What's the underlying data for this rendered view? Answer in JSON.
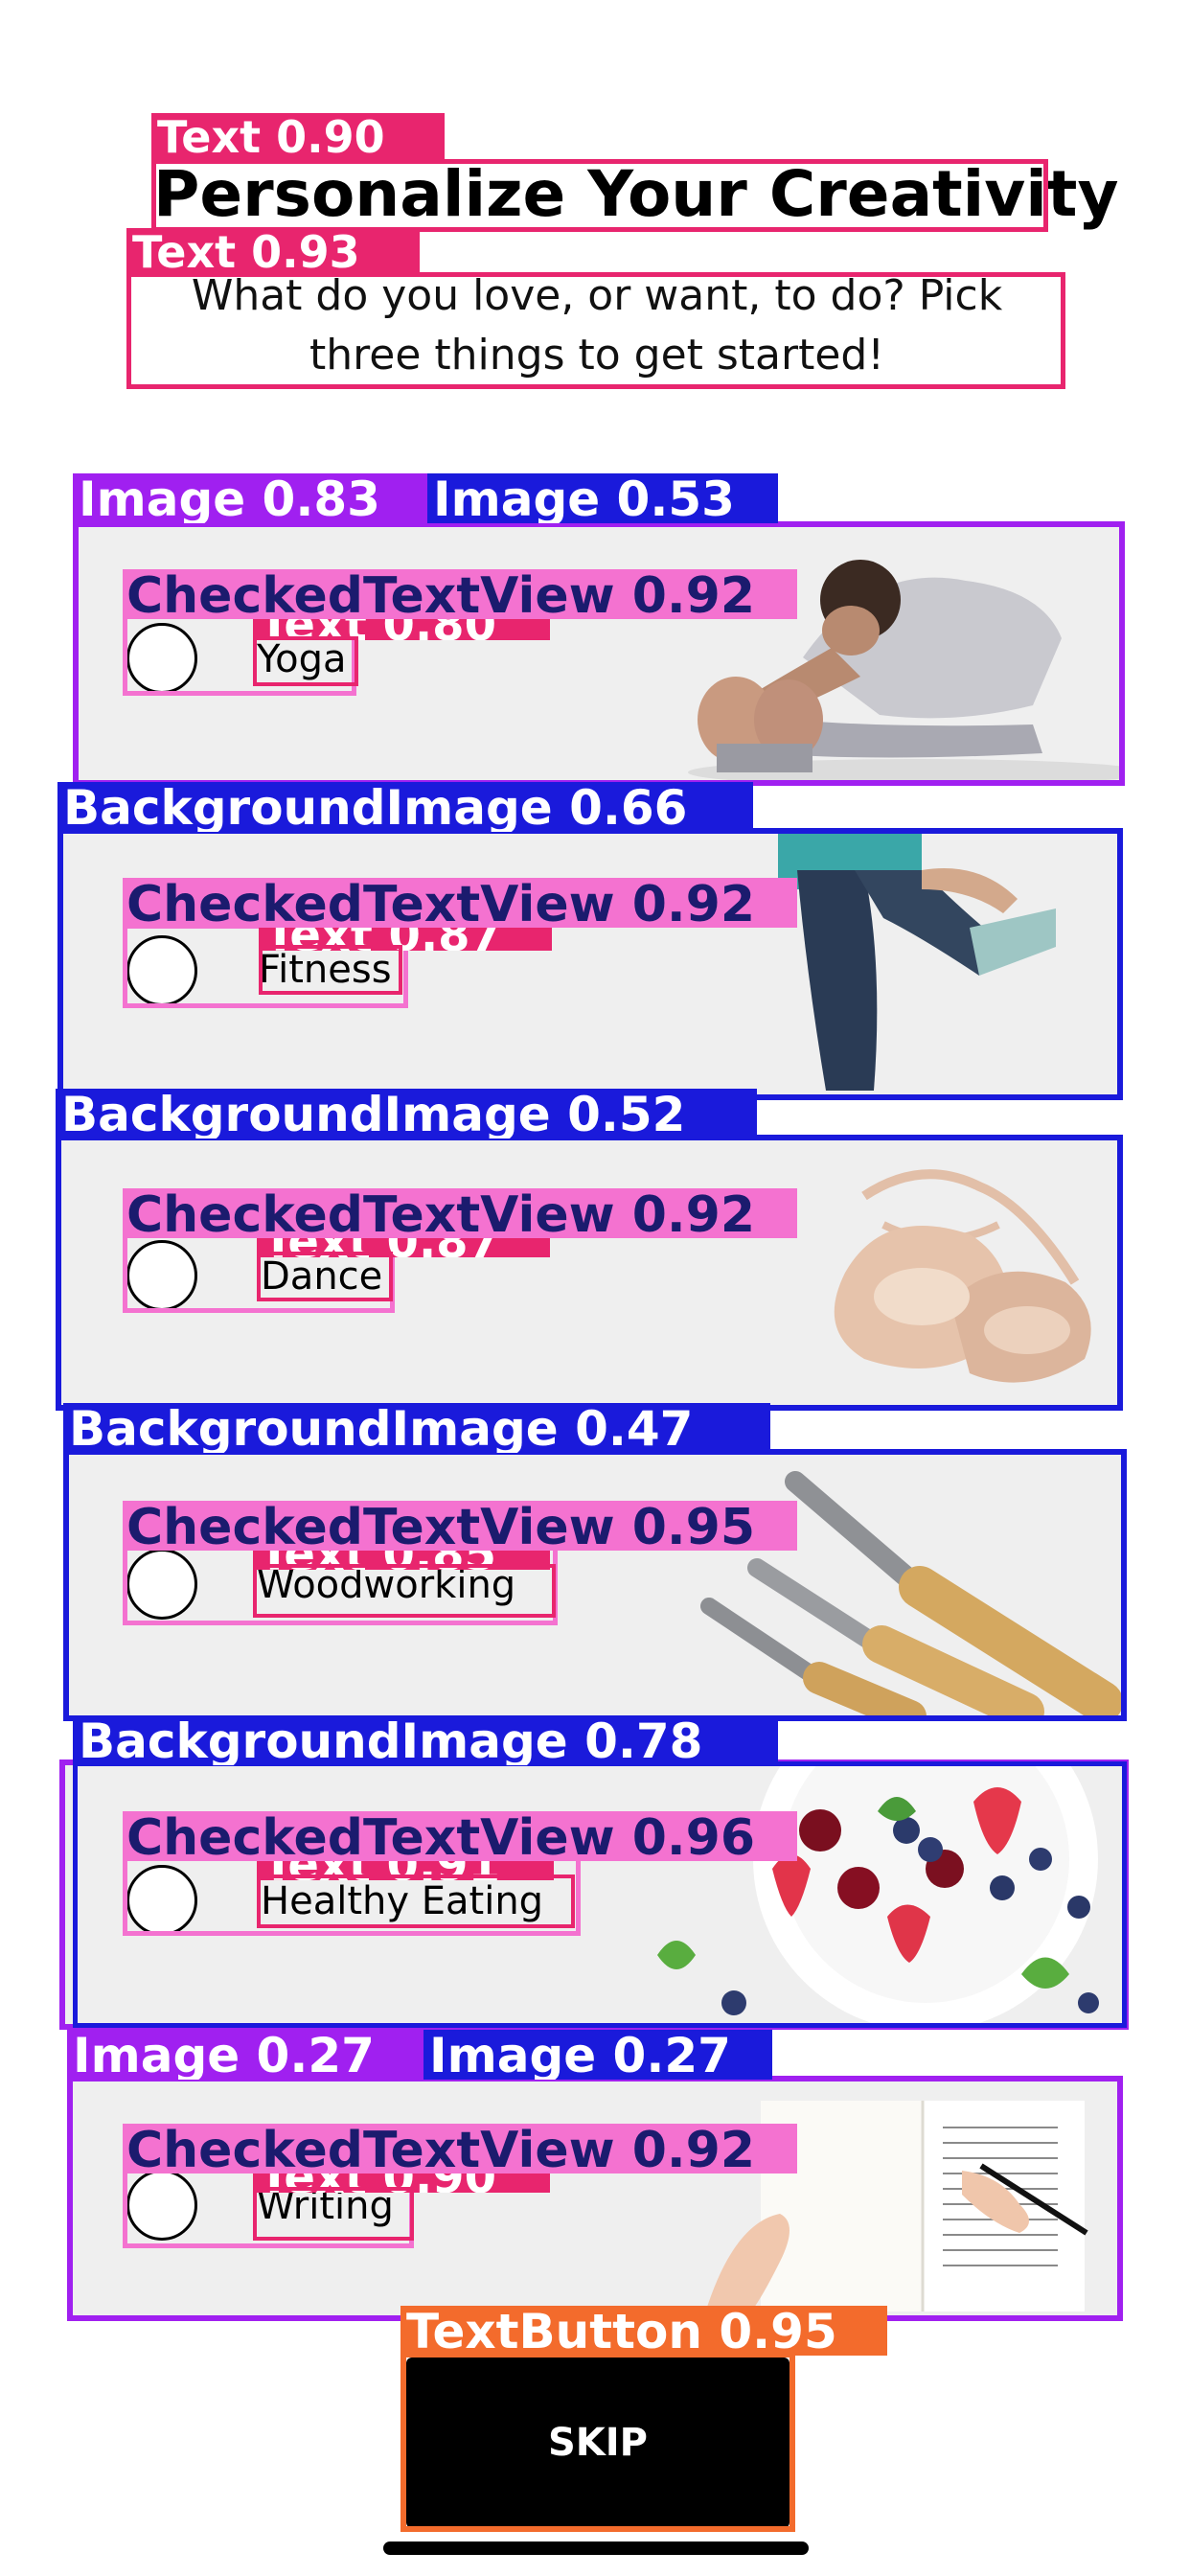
{
  "header": {
    "title": "Personalize Your Creativity",
    "subtitle": "What do you love, or want, to do? Pick three things to get started!"
  },
  "options": [
    {
      "label": "Yoga",
      "checked": false,
      "image": "yoga-woman-stretching"
    },
    {
      "label": "Fitness",
      "checked": false,
      "image": "fitness-legs-leggings"
    },
    {
      "label": "Dance",
      "checked": false,
      "image": "ballet-pointe-shoes"
    },
    {
      "label": "Woodworking",
      "checked": false,
      "image": "wood-chisels"
    },
    {
      "label": "Healthy Eating",
      "checked": false,
      "image": "fruit-bowl-berries"
    },
    {
      "label": "Writing",
      "checked": false,
      "image": "hand-writing-notebook"
    }
  ],
  "skip_button": {
    "label": "SKIP"
  },
  "detections": {
    "title": "Text 0.90",
    "subtitle": "Text 0.93",
    "yoga_image_a": "Image 0.83",
    "yoga_image_b": "Image 0.53",
    "yoga_checked": "CheckedTextView 0.92",
    "yoga_text": "Text 0.80",
    "fitness_bg": "BackgroundImage 0.66",
    "fitness_checked": "CheckedTextView 0.92",
    "fitness_text": "Text 0.87",
    "dance_bg": "BackgroundImage 0.52",
    "dance_checked": "CheckedTextView 0.92",
    "dance_text": "Text 0.87",
    "wood_bg": "BackgroundImage 0.47",
    "wood_checked": "CheckedTextView 0.95",
    "wood_text": "Text 0.85",
    "eating_bg": "BackgroundImage 0.78",
    "eating_checked": "CheckedTextView 0.96",
    "eating_text": "Text 0.91",
    "writing_image_a": "Image 0.27",
    "writing_image_b": "Image 0.27",
    "writing_checked": "CheckedTextView 0.92",
    "writing_text": "Text 0.90",
    "skip": "TextButton 0.95"
  },
  "colors": {
    "text_box": "#e8256e",
    "image_box": "#a020f0",
    "bg_box": "#1a1adb",
    "checked_box": "#f472d0",
    "button_box": "#f36b2c"
  }
}
